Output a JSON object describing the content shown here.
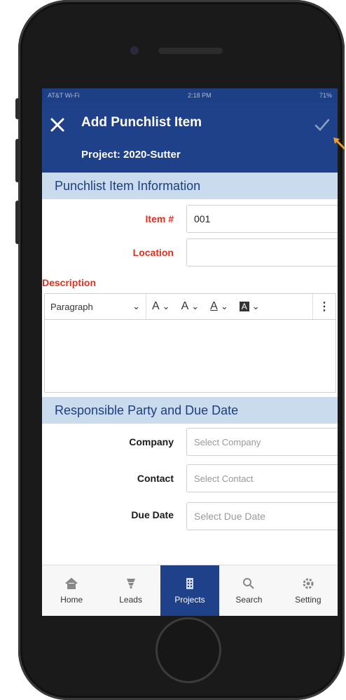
{
  "status": {
    "carrier": "AT&T Wi-Fi",
    "time": "2:18 PM",
    "battery": "71%"
  },
  "header": {
    "title": "Add Punchlist Item",
    "subtitle": "Project: 2020-Sutter"
  },
  "section1": {
    "title": "Punchlist Item Information"
  },
  "item": {
    "label": "Item #",
    "value": "001"
  },
  "location": {
    "label": "Location",
    "value": ""
  },
  "description": {
    "label": "Description"
  },
  "toolbar": {
    "paragraph": "Paragraph",
    "font_size": "A",
    "line_height": "A",
    "text_color": "A",
    "highlight": "A"
  },
  "section2": {
    "title": "Responsible Party and Due Date"
  },
  "company": {
    "label": "Company",
    "placeholder": "Select Company"
  },
  "contact": {
    "label": "Contact",
    "placeholder": "Select Contact"
  },
  "due_date": {
    "label": "Due Date",
    "placeholder": "Select Due Date"
  },
  "tabs": [
    {
      "label": "Home",
      "icon": "home-icon"
    },
    {
      "label": "Leads",
      "icon": "funnel-icon"
    },
    {
      "label": "Projects",
      "icon": "building-icon"
    },
    {
      "label": "Search",
      "icon": "search-icon"
    },
    {
      "label": "Setting",
      "icon": "gear-icon"
    }
  ],
  "colors": {
    "header": "#1e4189",
    "section": "#c9dbed",
    "required": "#e0301e",
    "arrow": "#f0a030"
  }
}
